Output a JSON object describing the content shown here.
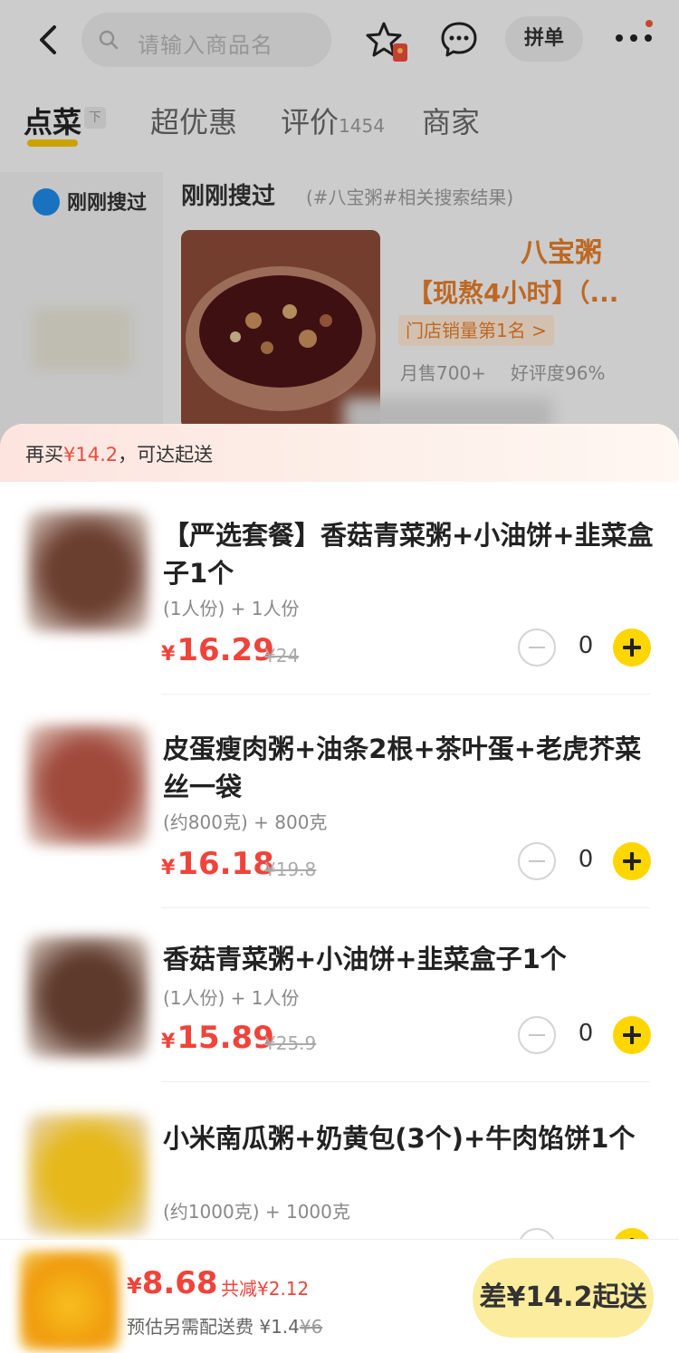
{
  "header": {
    "search_placeholder": "请输入商品名",
    "group_order_label": "拼单",
    "icons": [
      "back-arrow-icon",
      "search-icon",
      "favorite-star-icon",
      "message-icon",
      "more-icon"
    ]
  },
  "tabs": [
    {
      "label": "点菜",
      "active": true
    },
    {
      "label": "超优惠",
      "active": false
    },
    {
      "label": "评价",
      "count": "1454",
      "active": false
    },
    {
      "label": "商家",
      "active": false
    }
  ],
  "sort_icon_text": "下",
  "sidebar": {
    "recent_search_label": "刚刚搜过"
  },
  "recent": {
    "title": "刚刚搜过",
    "subtitle": "(#八宝粥#相关搜索结果)",
    "name_line1": "八宝粥",
    "name_line2": "【现熬4小时】（...",
    "rank_badge": "门店销量第1名 >",
    "sales": "月售700+",
    "rating": "好评度96%"
  },
  "cart": {
    "notice_prefix": "再买",
    "notice_amount": "¥14.2",
    "notice_suffix": "，可达起送",
    "currency": "¥",
    "items": [
      {
        "name": "【严选套餐】香菇青菜粥+小油饼+韭菜盒子1个",
        "spec": "(1人份) + 1人份",
        "price": "16.29",
        "original_price": "¥24",
        "quantity": "0",
        "thumb_color": "#6b3f30"
      },
      {
        "name": "皮蛋瘦肉粥+油条2根+茶叶蛋+老虎芥菜丝一袋",
        "spec": "(约800克) + 800克",
        "price": "16.18",
        "original_price": "¥19.8",
        "quantity": "0",
        "thumb_color": "#a04a3c"
      },
      {
        "name": "香菇青菜粥+小油饼+韭菜盒子1个",
        "spec": "(1人份) + 1人份",
        "price": "15.89",
        "original_price": "¥25.9",
        "quantity": "0",
        "thumb_color": "#5e3a2c"
      },
      {
        "name": "小米南瓜粥+奶黄包(3个)+牛肉馅饼1个",
        "spec": "(约1000克) + 1000克",
        "price": "",
        "original_price": "",
        "quantity": "",
        "thumb_color": "#e6b81a"
      }
    ]
  },
  "bottom_bar": {
    "total": "8.68",
    "discount": "共减¥2.12",
    "delivery_fee_label": "预估另需配送费 ¥1.4",
    "delivery_fee_original": "¥6",
    "checkout_label": "差¥14.2起送"
  },
  "colors": {
    "accent_yellow": "#ffd600",
    "price_red": "#f0433a",
    "rank_orange": "#e27d2a"
  }
}
